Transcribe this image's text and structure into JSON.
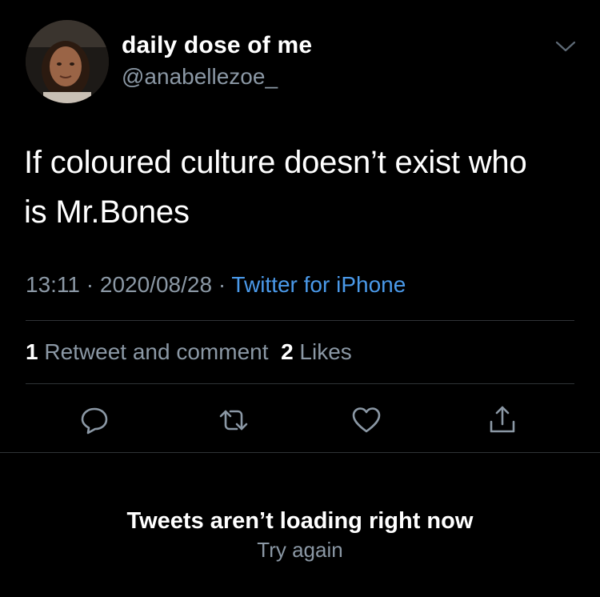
{
  "author": {
    "display_name": "daily dose of me",
    "handle": "@anabellezoe_",
    "avatar_icon": "profile-photo"
  },
  "tweet": {
    "text_line1": "If coloured culture doesn’t exist who",
    "text_line2": "is Mr.Bones",
    "time": "13:11",
    "date": "2020/08/28",
    "separator": "·",
    "source": "Twitter for iPhone"
  },
  "stats": {
    "retweets_count": "1",
    "retweets_label": "Retweet and comment",
    "likes_count": "2",
    "likes_label": "Likes"
  },
  "actions": [
    {
      "icon": "reply-icon"
    },
    {
      "icon": "retweet-icon"
    },
    {
      "icon": "like-icon"
    },
    {
      "icon": "share-icon"
    }
  ],
  "timeline": {
    "error_message": "Tweets aren’t loading right now",
    "retry_label": "Try again"
  },
  "colors": {
    "background": "#000000",
    "text_primary": "#ffffff",
    "text_secondary": "#8b98a5",
    "link": "#4a99e9",
    "divider": "#2f3336"
  }
}
